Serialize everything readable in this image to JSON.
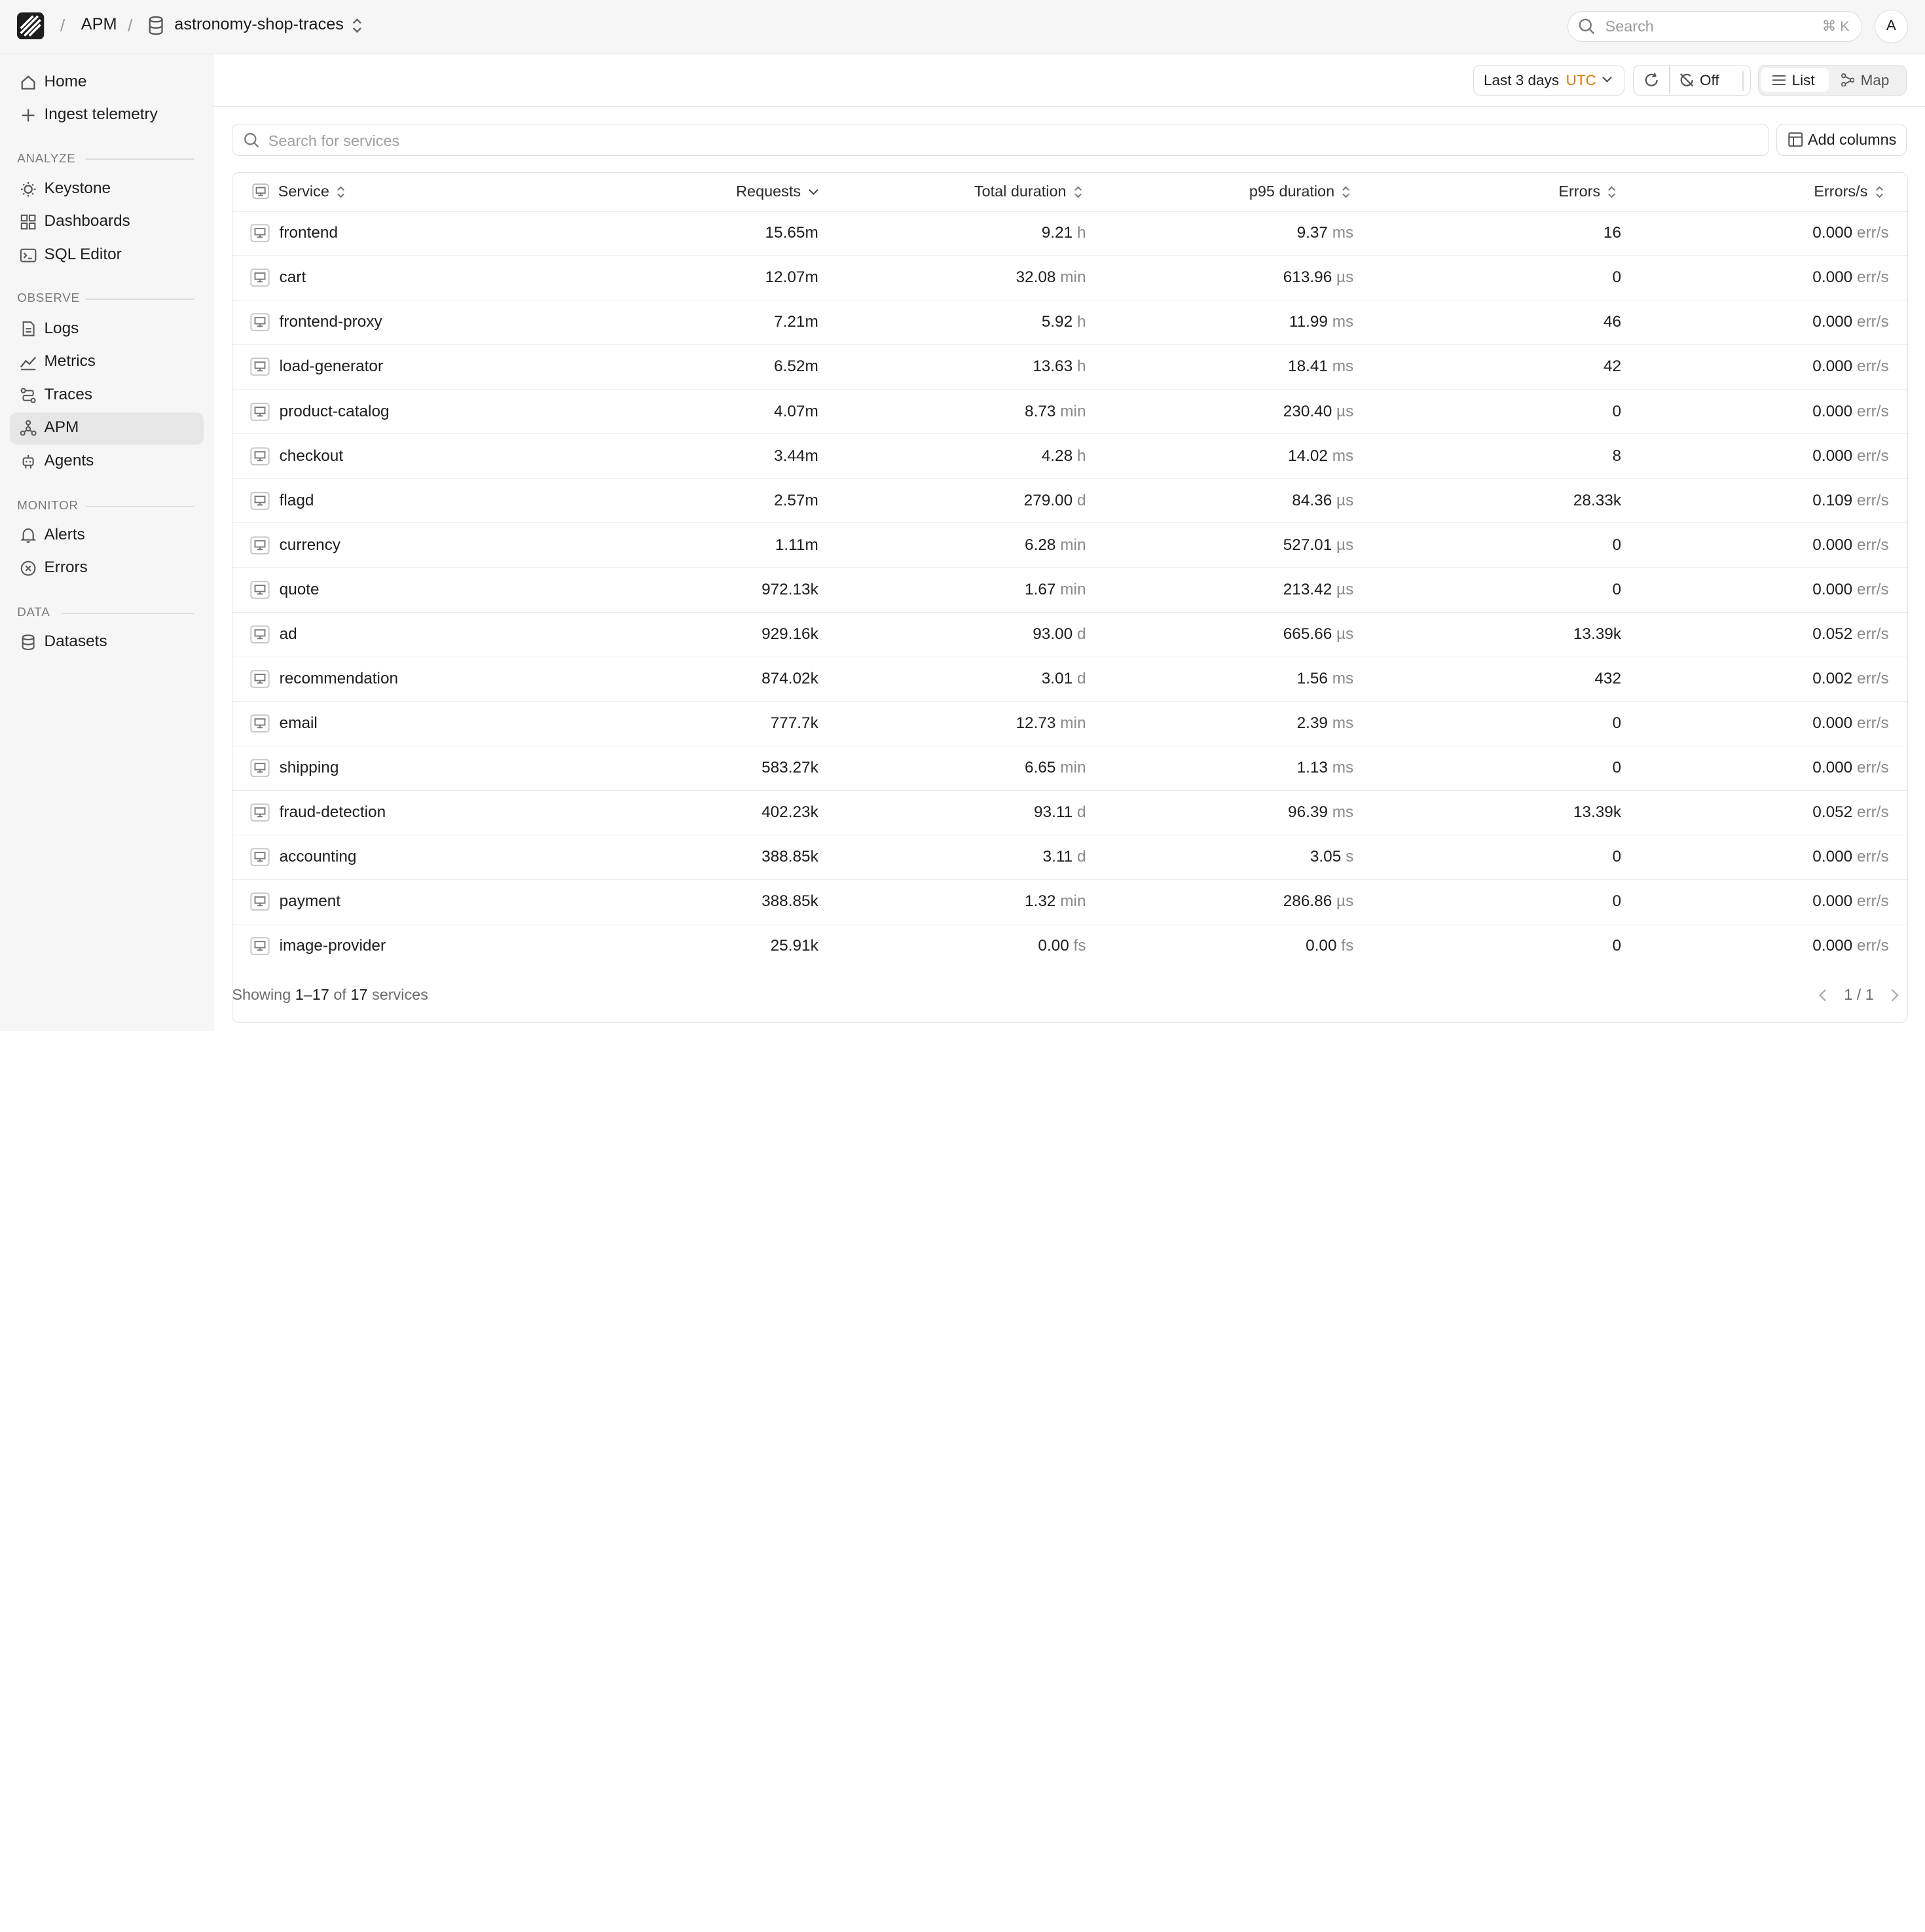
{
  "breadcrumb": {
    "app": "APM",
    "dataset": "astronomy-shop-traces"
  },
  "search": {
    "placeholder": "Search",
    "shortcut": "⌘ K"
  },
  "user": {
    "avatar_initial": "A"
  },
  "sidebar": {
    "top": [
      {
        "label": "Home",
        "icon": "home-icon"
      },
      {
        "label": "Ingest telemetry",
        "icon": "plus-icon"
      }
    ],
    "sections": [
      {
        "title": "ANALYZE",
        "items": [
          {
            "label": "Keystone",
            "icon": "lightbulb-icon"
          },
          {
            "label": "Dashboards",
            "icon": "dashboard-icon"
          },
          {
            "label": "SQL Editor",
            "icon": "terminal-icon"
          }
        ]
      },
      {
        "title": "OBSERVE",
        "items": [
          {
            "label": "Logs",
            "icon": "document-icon"
          },
          {
            "label": "Metrics",
            "icon": "chart-line-icon"
          },
          {
            "label": "Traces",
            "icon": "trace-icon"
          },
          {
            "label": "APM",
            "icon": "apm-icon",
            "active": true
          },
          {
            "label": "Agents",
            "icon": "robot-icon"
          }
        ]
      },
      {
        "title": "MONITOR",
        "items": [
          {
            "label": "Alerts",
            "icon": "bell-icon"
          },
          {
            "label": "Errors",
            "icon": "x-circle-icon"
          }
        ]
      },
      {
        "title": "DATA",
        "items": [
          {
            "label": "Datasets",
            "icon": "database-icon"
          }
        ]
      }
    ]
  },
  "toolbar": {
    "time_range": "Last 3 days",
    "timezone": "UTC",
    "auto_refresh": "Off",
    "view_list": "List",
    "view_map": "Map"
  },
  "filter": {
    "placeholder": "Search for services",
    "add_columns": "Add columns"
  },
  "table": {
    "columns": [
      "Service",
      "Requests",
      "Total duration",
      "p95 duration",
      "Errors",
      "Errors/s"
    ],
    "rows": [
      {
        "service": "frontend",
        "requests": "15.65m",
        "total": "9.21",
        "total_unit": "h",
        "p95": "9.37",
        "p95_unit": "ms",
        "errors": "16",
        "eps": "0.000",
        "eps_unit": "err/s"
      },
      {
        "service": "cart",
        "requests": "12.07m",
        "total": "32.08",
        "total_unit": "min",
        "p95": "613.96",
        "p95_unit": "µs",
        "errors": "0",
        "eps": "0.000",
        "eps_unit": "err/s"
      },
      {
        "service": "frontend-proxy",
        "requests": "7.21m",
        "total": "5.92",
        "total_unit": "h",
        "p95": "11.99",
        "p95_unit": "ms",
        "errors": "46",
        "eps": "0.000",
        "eps_unit": "err/s"
      },
      {
        "service": "load-generator",
        "requests": "6.52m",
        "total": "13.63",
        "total_unit": "h",
        "p95": "18.41",
        "p95_unit": "ms",
        "errors": "42",
        "eps": "0.000",
        "eps_unit": "err/s"
      },
      {
        "service": "product-catalog",
        "requests": "4.07m",
        "total": "8.73",
        "total_unit": "min",
        "p95": "230.40",
        "p95_unit": "µs",
        "errors": "0",
        "eps": "0.000",
        "eps_unit": "err/s"
      },
      {
        "service": "checkout",
        "requests": "3.44m",
        "total": "4.28",
        "total_unit": "h",
        "p95": "14.02",
        "p95_unit": "ms",
        "errors": "8",
        "eps": "0.000",
        "eps_unit": "err/s"
      },
      {
        "service": "flagd",
        "requests": "2.57m",
        "total": "279.00",
        "total_unit": "d",
        "p95": "84.36",
        "p95_unit": "µs",
        "errors": "28.33k",
        "eps": "0.109",
        "eps_unit": "err/s"
      },
      {
        "service": "currency",
        "requests": "1.11m",
        "total": "6.28",
        "total_unit": "min",
        "p95": "527.01",
        "p95_unit": "µs",
        "errors": "0",
        "eps": "0.000",
        "eps_unit": "err/s"
      },
      {
        "service": "quote",
        "requests": "972.13k",
        "total": "1.67",
        "total_unit": "min",
        "p95": "213.42",
        "p95_unit": "µs",
        "errors": "0",
        "eps": "0.000",
        "eps_unit": "err/s"
      },
      {
        "service": "ad",
        "requests": "929.16k",
        "total": "93.00",
        "total_unit": "d",
        "p95": "665.66",
        "p95_unit": "µs",
        "errors": "13.39k",
        "eps": "0.052",
        "eps_unit": "err/s"
      },
      {
        "service": "recommendation",
        "requests": "874.02k",
        "total": "3.01",
        "total_unit": "d",
        "p95": "1.56",
        "p95_unit": "ms",
        "errors": "432",
        "eps": "0.002",
        "eps_unit": "err/s"
      },
      {
        "service": "email",
        "requests": "777.7k",
        "total": "12.73",
        "total_unit": "min",
        "p95": "2.39",
        "p95_unit": "ms",
        "errors": "0",
        "eps": "0.000",
        "eps_unit": "err/s"
      },
      {
        "service": "shipping",
        "requests": "583.27k",
        "total": "6.65",
        "total_unit": "min",
        "p95": "1.13",
        "p95_unit": "ms",
        "errors": "0",
        "eps": "0.000",
        "eps_unit": "err/s"
      },
      {
        "service": "fraud-detection",
        "requests": "402.23k",
        "total": "93.11",
        "total_unit": "d",
        "p95": "96.39",
        "p95_unit": "ms",
        "errors": "13.39k",
        "eps": "0.052",
        "eps_unit": "err/s"
      },
      {
        "service": "accounting",
        "requests": "388.85k",
        "total": "3.11",
        "total_unit": "d",
        "p95": "3.05",
        "p95_unit": "s",
        "errors": "0",
        "eps": "0.000",
        "eps_unit": "err/s"
      },
      {
        "service": "payment",
        "requests": "388.85k",
        "total": "1.32",
        "total_unit": "min",
        "p95": "286.86",
        "p95_unit": "µs",
        "errors": "0",
        "eps": "0.000",
        "eps_unit": "err/s"
      },
      {
        "service": "image-provider",
        "requests": "25.91k",
        "total": "0.00",
        "total_unit": "fs",
        "p95": "0.00",
        "p95_unit": "fs",
        "errors": "0",
        "eps": "0.000",
        "eps_unit": "err/s"
      }
    ]
  },
  "footer": {
    "prefix": "Showing",
    "range": "1–17",
    "of": "of",
    "total": "17",
    "suffix": "services",
    "page": "1 / 1"
  },
  "colors": {
    "accent_utc": "#d97706",
    "sidebar_bg": "#f6f6f6",
    "active_bg": "#e6e6e6"
  }
}
